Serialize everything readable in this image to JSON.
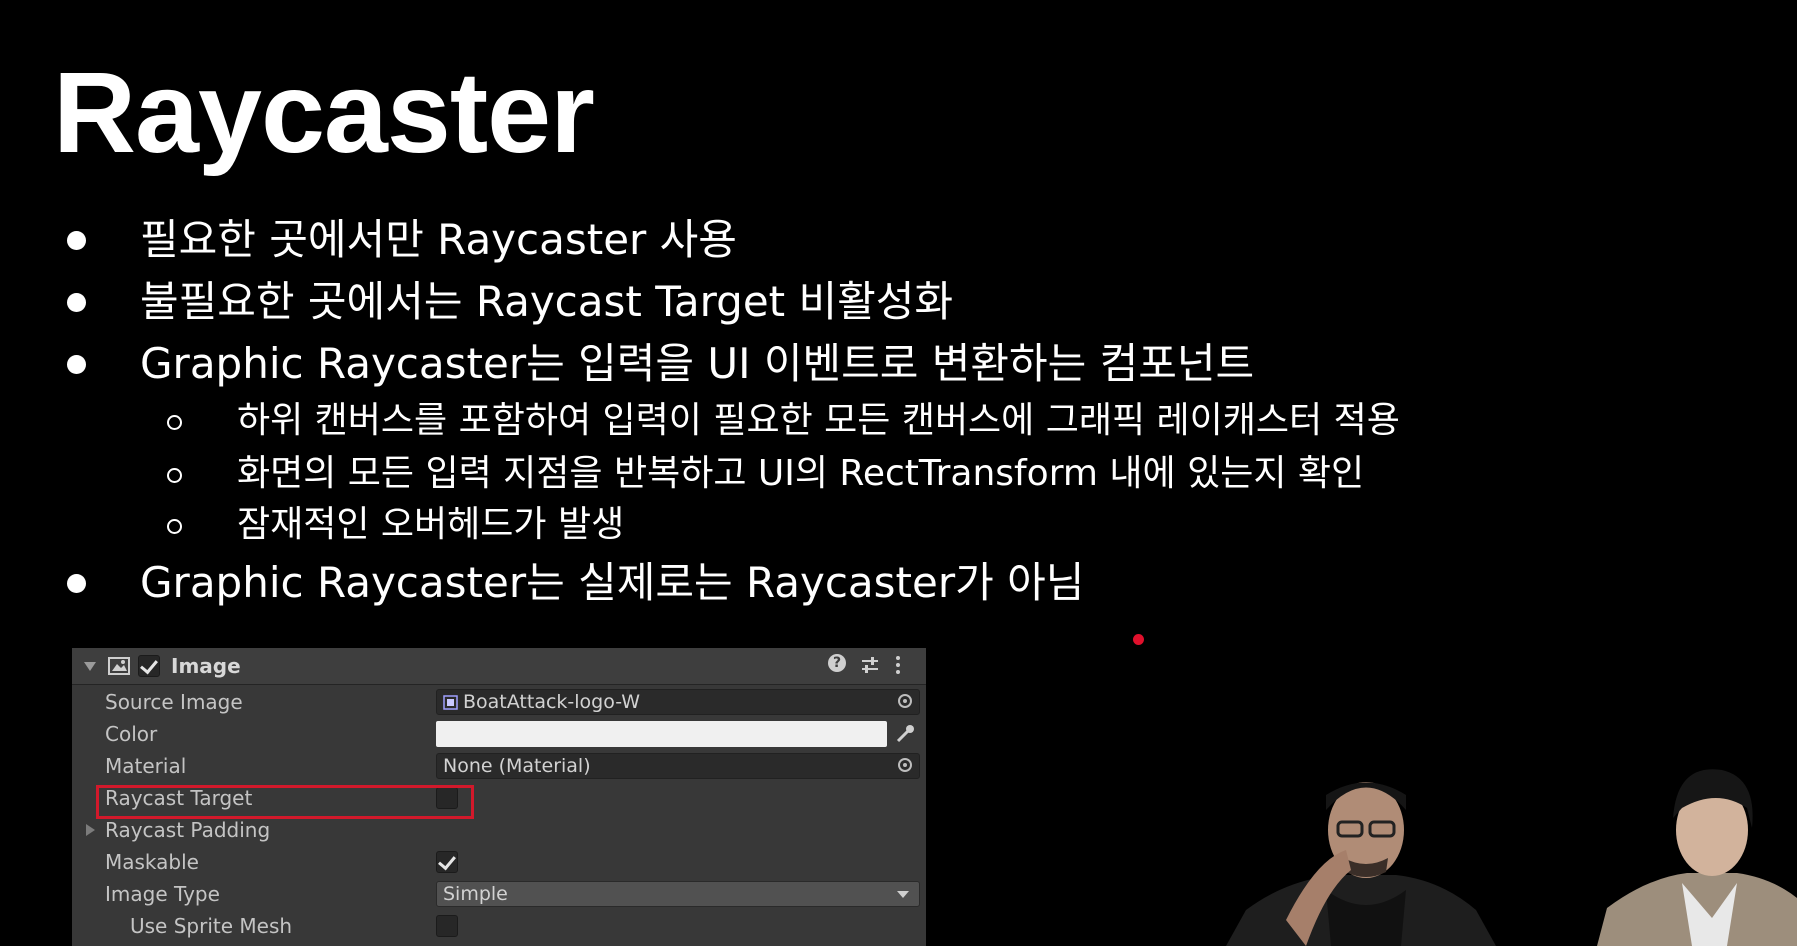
{
  "slide": {
    "title": "Raycaster",
    "bullets": [
      "필요한 곳에서만 Raycaster 사용",
      "불필요한 곳에서는 Raycast Target 비활성화",
      "Graphic Raycaster는 입력을 UI 이벤트로 변환하는 컴포넌트"
    ],
    "sub_bullets": [
      "하위 캔버스를 포함하여 입력이 필요한 모든 캔버스에 그래픽 레이캐스터 적용",
      "화면의 모든 입력 지점을 반복하고 UI의 RectTransform 내에 있는지 확인",
      "잠재적인 오버헤드가 발생"
    ],
    "last_bullet": "Graphic Raycaster는 실제로는 Raycaster가 아님"
  },
  "inspector": {
    "component_title": "Image",
    "component_enabled": true,
    "header_icons": [
      "help-icon",
      "presets-icon",
      "more-menu-icon"
    ],
    "rows": {
      "source_image_label": "Source Image",
      "source_image_value": "BoatAttack-logo-W",
      "color_label": "Color",
      "color_value": "#f0f0f0",
      "material_label": "Material",
      "material_value": "None (Material)",
      "raycast_target_label": "Raycast Target",
      "raycast_target_checked": false,
      "raycast_padding_label": "Raycast Padding",
      "maskable_label": "Maskable",
      "maskable_checked": true,
      "image_type_label": "Image Type",
      "image_type_value": "Simple",
      "use_sprite_mesh_label": "Use Sprite Mesh",
      "use_sprite_mesh_checked": false
    },
    "highlight_color": "#d2192b"
  },
  "overlay": {
    "laser_pointer_color": "#e0102c"
  }
}
